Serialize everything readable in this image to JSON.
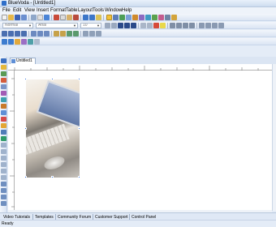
{
  "window": {
    "title": "BlueVoda - [Untitled1]"
  },
  "menu": [
    "File",
    "Edit",
    "View",
    "Insert",
    "Format",
    "Table",
    "Layout",
    "Tools",
    "Window",
    "Help"
  ],
  "format_bar": {
    "style": "Normal",
    "font": "Arial",
    "size": "10"
  },
  "document_tab": {
    "label": "Untitled1"
  },
  "bottom_tabs": [
    "Video Tutorials",
    "Templates",
    "Community Forum",
    "Customer Support",
    "Control Panel"
  ],
  "status": {
    "text": "Ready"
  },
  "colors": {
    "selection_handle": "#2f6fe0",
    "accent": "#2f6fc9"
  }
}
